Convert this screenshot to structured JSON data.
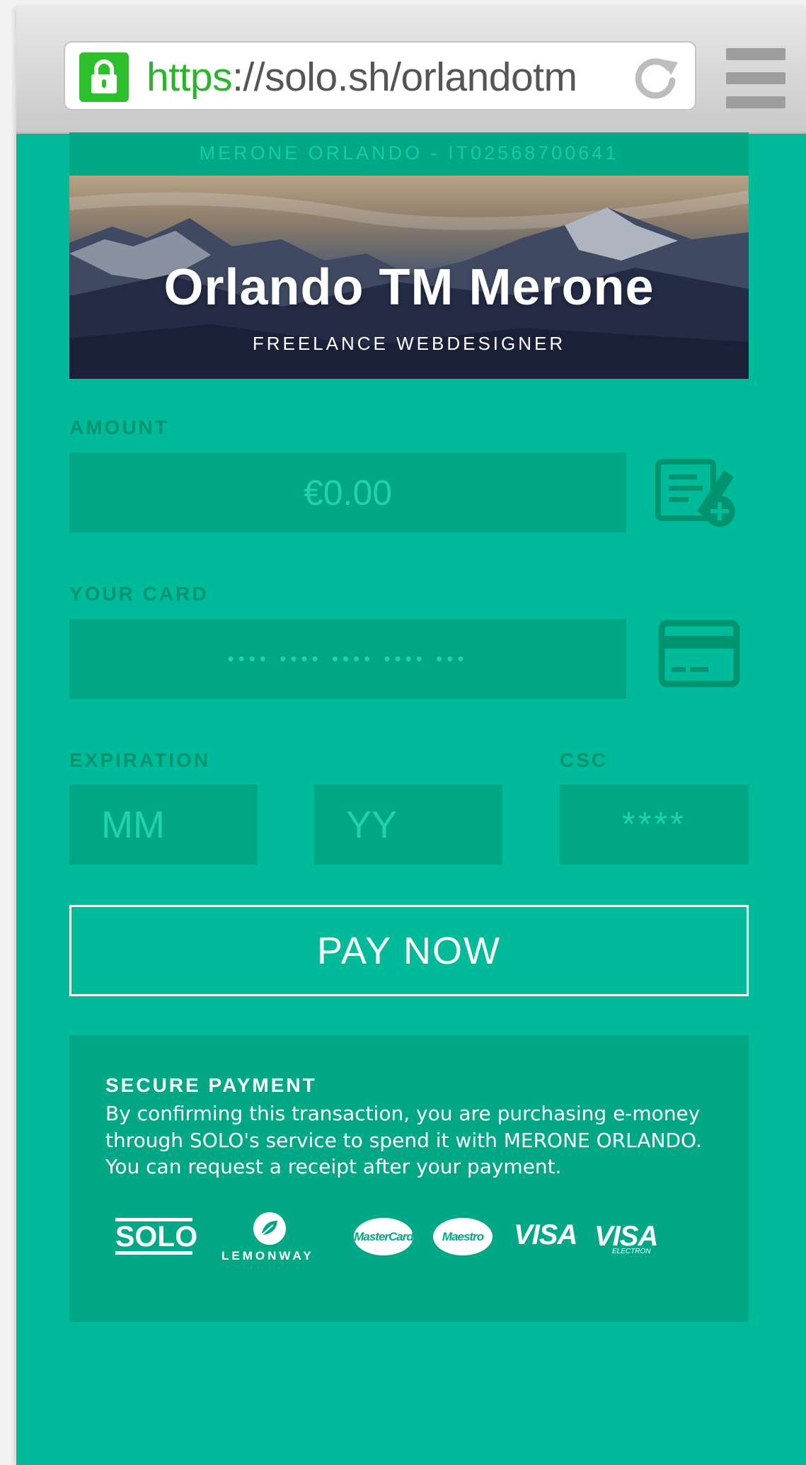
{
  "browser": {
    "url_scheme": "https",
    "url_rest": "://solo.sh/orlandotm"
  },
  "merchant": {
    "strip": "MERONE ORLANDO - IT02568700641",
    "name": "Orlando TM Merone",
    "tagline": "FREELANCE WEBDESIGNER"
  },
  "form": {
    "amount_label": "AMOUNT",
    "amount_value": "€0.00",
    "card_label": "YOUR CARD",
    "card_placeholder": "•••• •••• •••• •••• •••",
    "expiration_label": "EXPIRATION",
    "mm_placeholder": "MM",
    "yy_placeholder": "YY",
    "csc_label": "CSC",
    "csc_placeholder": "****",
    "pay_button": "PAY NOW"
  },
  "secure": {
    "title": "SECURE PAYMENT",
    "text": "By confirming this transaction, you are purchasing e-money through SOLO's service to spend it with MERONE ORLANDO. You can request a receipt after your payment.",
    "logos": {
      "solo": "SOLO",
      "lemonway": "LEMONWAY",
      "mastercard": "MasterCard",
      "maestro": "Maestro",
      "visa": "VISA",
      "visa_electron": "VISA",
      "visa_electron_sub": "ELECTRON"
    }
  },
  "colors": {
    "background": "#00bb99",
    "field": "#00a785",
    "label": "#00936f",
    "lock": "#2cc12c"
  },
  "icons": [
    "lock-icon",
    "reload-icon",
    "menu-icon",
    "edit-amount-icon",
    "credit-card-icon",
    "leaf-icon"
  ]
}
